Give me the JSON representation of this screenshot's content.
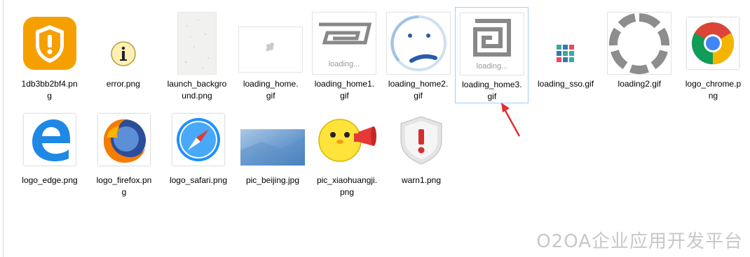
{
  "files_row1": [
    {
      "name": "1db3bb2bf4.png",
      "icon": "shield-warning-icon"
    },
    {
      "name": "error.png",
      "icon": "info-icon"
    },
    {
      "name": "launch_background.png",
      "icon": "speckled-paper-image"
    },
    {
      "name": "loading_home.gif",
      "icon": "blank-loading-gif"
    },
    {
      "name": "loading_home1.gif",
      "icon": "loading-spiral-gif"
    },
    {
      "name": "loading_home2.gif",
      "icon": "smiley-loading-gif"
    },
    {
      "name": "loading_home3.gif",
      "icon": "loading-spiral-gif",
      "selected": true
    },
    {
      "name": "loading_sso.gif",
      "icon": "tile-dots-gif"
    },
    {
      "name": "loading2.gif",
      "icon": "segmented-ring-gif"
    },
    {
      "name": "logo_chrome.png",
      "icon": "chrome-logo"
    }
  ],
  "files_row2": [
    {
      "name": "logo_edge.png",
      "icon": "edge-logo"
    },
    {
      "name": "logo_firefox.png",
      "icon": "firefox-logo"
    },
    {
      "name": "logo_safari.png",
      "icon": "safari-logo"
    },
    {
      "name": "pic_beijing.jpg",
      "icon": "blue-gradient-image"
    },
    {
      "name": "pic_xiaohuangji.png",
      "icon": "yellow-chick-image"
    },
    {
      "name": "warn1.png",
      "icon": "red-exclamation-shield-icon"
    }
  ],
  "labels": {
    "f0": "1db3bb2bf4.pn\ng",
    "f1": "error.png",
    "f2": "launch_backgro\nund.png",
    "f3": "loading_home.\ngif",
    "f4": "loading_home1.\ngif",
    "f5": "loading_home2.\ngif",
    "f6": "loading_home3.\ngif",
    "f7": "loading_sso.gif",
    "f8": "loading2.gif",
    "f9": "logo_chrome.p\nng",
    "f10": "logo_edge.png",
    "f11": "logo_firefox.pn\ng",
    "f12": "logo_safari.png",
    "f13": "pic_beijing.jpg",
    "f14": "pic_xiaohuangji.\npng",
    "f15": "warn1.png"
  },
  "loading_text": "loading...",
  "watermark": "O2OA企业应用开发平台",
  "colors": {
    "selection_border": "#99d1ff",
    "arrow": "#e03030",
    "shield_orange": "#f5a000"
  }
}
